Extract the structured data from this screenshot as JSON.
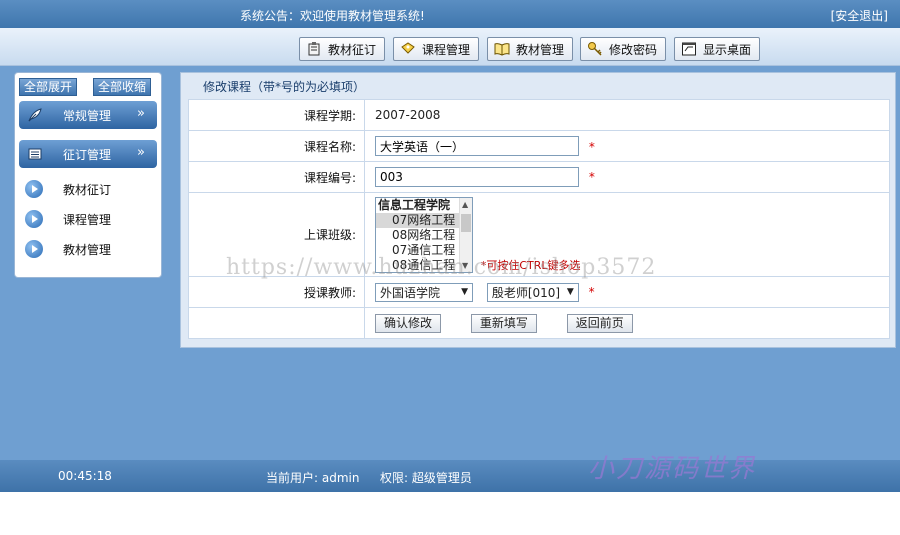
{
  "topbar": {
    "notice": "系统公告：欢迎使用教材管理系统!",
    "logout": "[安全退出]"
  },
  "toolbar": [
    {
      "label": "教材征订",
      "icon": "book-stack-icon"
    },
    {
      "label": "课程管理",
      "icon": "tag-icon"
    },
    {
      "label": "教材管理",
      "icon": "open-book-icon"
    },
    {
      "label": "修改密码",
      "icon": "key-icon"
    },
    {
      "label": "显示桌面",
      "icon": "desktop-icon"
    }
  ],
  "sidebar": {
    "expand_all": "全部展开",
    "collapse_all": "全部收缩",
    "sections": [
      {
        "label": "常规管理",
        "icon": "feather-icon",
        "chevron": "»"
      },
      {
        "label": "征订管理",
        "icon": "list-icon",
        "chevron": "»"
      }
    ],
    "items": [
      "教材征订",
      "课程管理",
      "教材管理"
    ]
  },
  "panel": {
    "title": "修改课程（带*号的为必填项）",
    "fields": {
      "term": {
        "label": "课程学期:",
        "value": "2007-2008"
      },
      "name": {
        "label": "课程名称:",
        "value": "大学英语（一）"
      },
      "code": {
        "label": "课程编号:",
        "value": "003"
      },
      "classes": {
        "label": "上课班级:",
        "group": "信息工程学院",
        "options": [
          "07网络工程",
          "08网络工程",
          "07通信工程",
          "08通信工程"
        ],
        "hint": "*可按住CTRL键多选"
      },
      "teacher": {
        "label": "授课教师:",
        "college": "外国语学院",
        "teacher": "殷老师[010]"
      }
    },
    "required_mark": "*",
    "buttons": {
      "confirm": "确认修改",
      "reset": "重新填写",
      "back": "返回前页"
    }
  },
  "statusbar": {
    "time": "00:45:18",
    "user": "当前用户: admin",
    "role": "权限: 超级管理员"
  },
  "watermarks": {
    "url": "https://www.huzhan.com/ishop3572",
    "brand": "小刀源码世界"
  }
}
